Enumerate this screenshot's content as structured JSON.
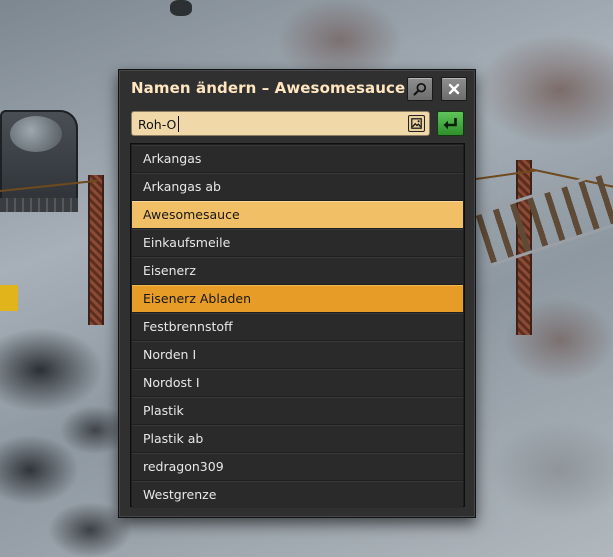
{
  "dialog": {
    "title": "Namen ändern – Awesomesauce",
    "search_button_icon": "magnifier-icon",
    "close_button_icon": "close-x-icon"
  },
  "name_field": {
    "value": "Roh-O",
    "rich_text_icon": "image-icon",
    "confirm_icon": "enter-arrow-icon"
  },
  "stations": [
    {
      "label": "Arkangas",
      "state": "normal"
    },
    {
      "label": "Arkangas ab",
      "state": "normal"
    },
    {
      "label": "Awesomesauce",
      "state": "current"
    },
    {
      "label": "Einkaufsmeile",
      "state": "normal"
    },
    {
      "label": "Eisenerz",
      "state": "normal"
    },
    {
      "label": "Eisenerz Abladen",
      "state": "hovered"
    },
    {
      "label": "Festbrennstoff",
      "state": "normal"
    },
    {
      "label": "Norden I",
      "state": "normal"
    },
    {
      "label": "Nordost I",
      "state": "normal"
    },
    {
      "label": "Plastik",
      "state": "normal"
    },
    {
      "label": "Plastik ab",
      "state": "normal"
    },
    {
      "label": "redragon309",
      "state": "normal"
    },
    {
      "label": "Westgrenze",
      "state": "normal"
    }
  ],
  "colors": {
    "title": "#ffe6c0",
    "current_row": "#f1c066",
    "hovered_row": "#e79c27",
    "confirm": "#3aa636"
  }
}
